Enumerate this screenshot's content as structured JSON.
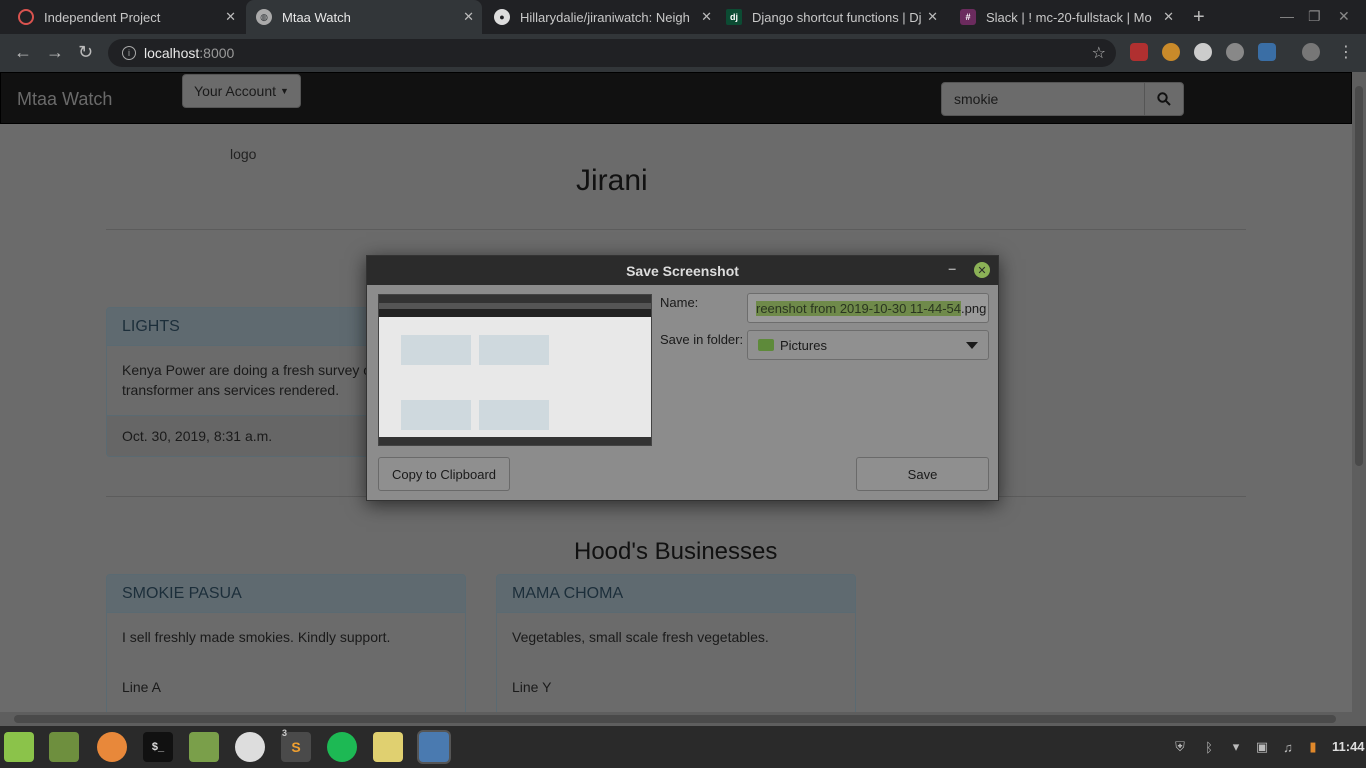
{
  "browser": {
    "tabs": [
      {
        "label": "Independent Project",
        "favicon": "ubuntu-icon"
      },
      {
        "label": "Mtaa Watch",
        "favicon": "globe-icon"
      },
      {
        "label": "Hillarydalie/jiraniwatch: Neigh",
        "favicon": "github-icon"
      },
      {
        "label": "Django shortcut functions | Dj",
        "favicon": "dj"
      },
      {
        "label": "Slack | ! mc-20-fullstack | Mo",
        "favicon": "slack-icon"
      }
    ],
    "url_host": "localhost",
    "url_port": ":8000"
  },
  "site": {
    "brand": "Mtaa Watch",
    "account_button": "Your Account",
    "search_value": "smokie",
    "logo_alt": "logo",
    "hood_name": "Jirani",
    "notice": {
      "title": "LIGHTS",
      "body": "Kenya Power are doing a fresh survey on transformer ans services rendered.",
      "body_line1": "Kenya Power are doing a fresh survey o",
      "body_line2": "transformer ans services rendered.",
      "date": "Oct. 30, 2019, 8:31 a.m."
    },
    "businesses_title": "Hood's Businesses",
    "businesses": [
      {
        "name": "SMOKIE PASUA",
        "description": "I sell freshly made smokies. Kindly support.",
        "location": "Line A"
      },
      {
        "name": "MAMA CHOMA",
        "description": "Vegetables, small scale fresh vegetables.",
        "location": "Line Y"
      }
    ]
  },
  "dialog": {
    "title": "Save Screenshot",
    "name_label": "Name:",
    "name_selected": "reenshot from 2019-10-30 11-44-54",
    "name_ext": ".png",
    "folder_label": "Save in folder:",
    "folder_value": "Pictures",
    "copy_button": "Copy to Clipboard",
    "save_button": "Save"
  },
  "taskbar": {
    "clock": "11:44",
    "sublime_badge": "3"
  }
}
